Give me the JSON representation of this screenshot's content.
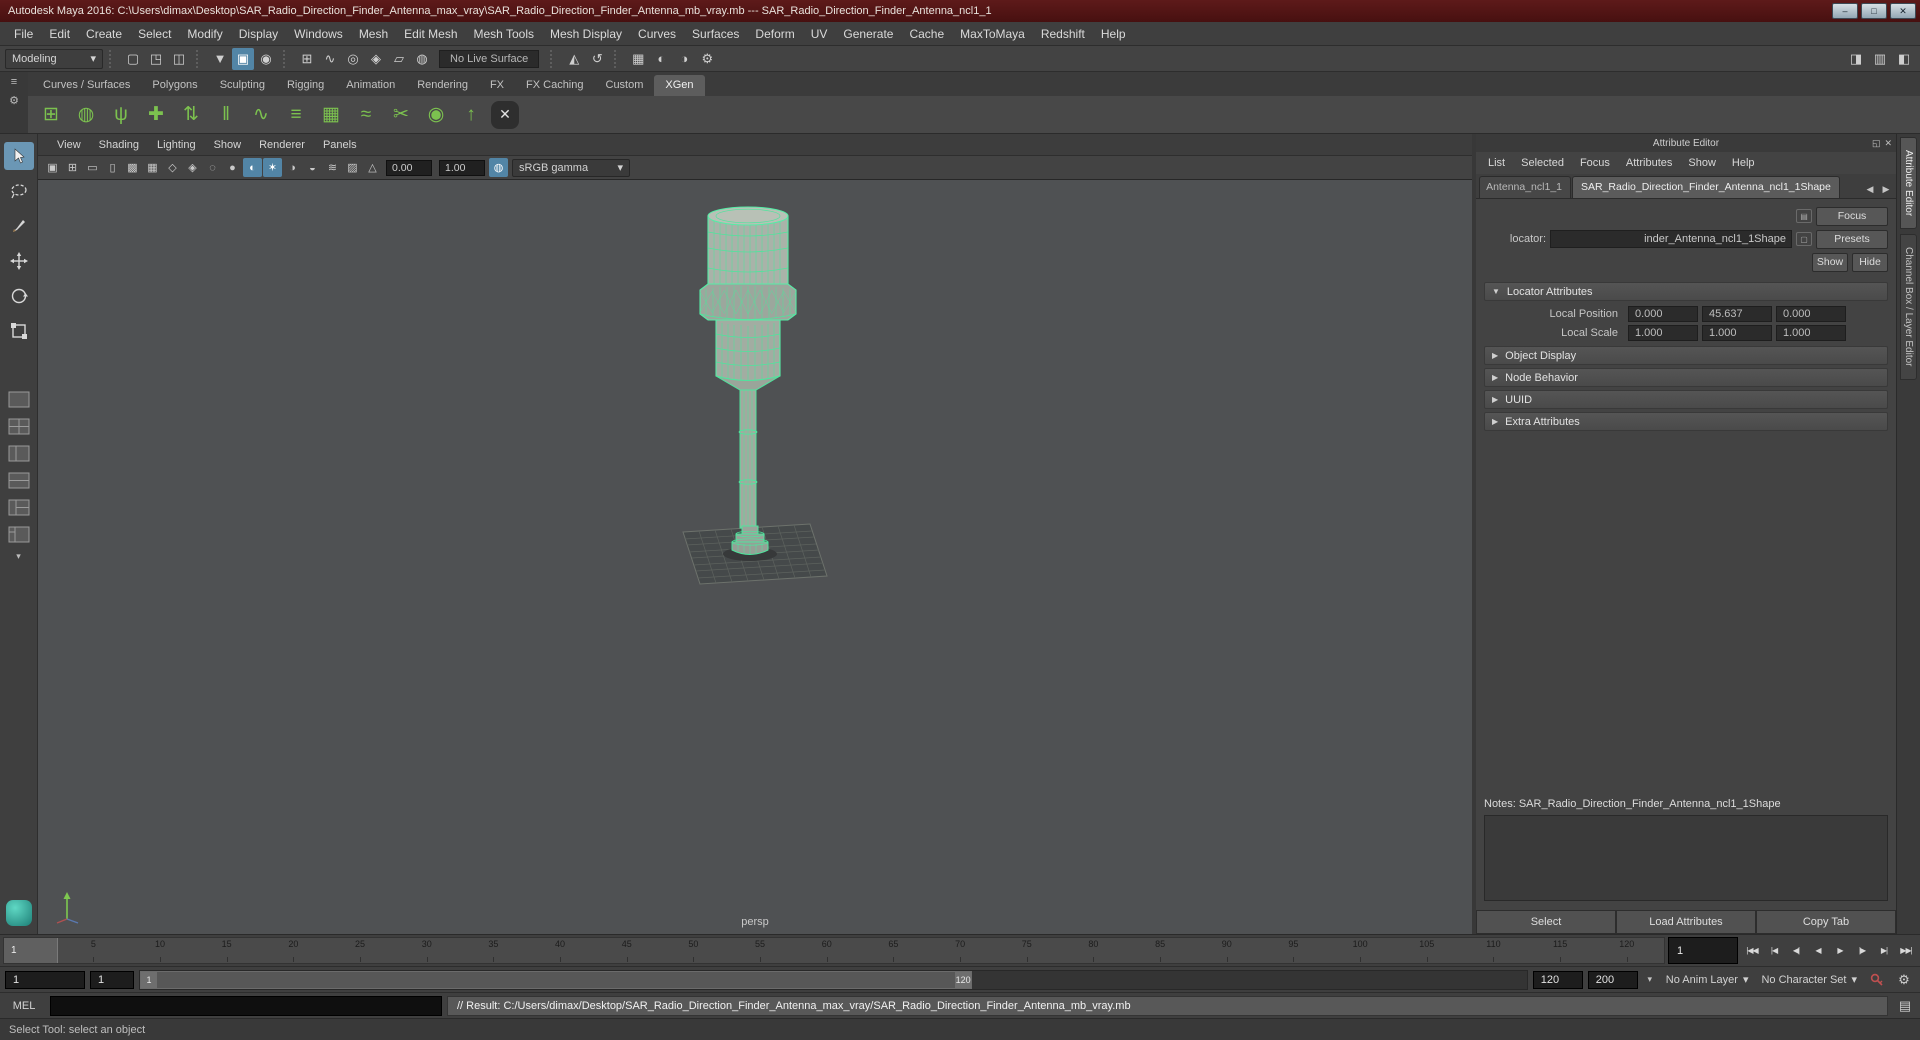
{
  "icons": {
    "window_min": "–",
    "window_max": "□",
    "window_close": "✕",
    "caret_down": "▾",
    "panel_float": "◱",
    "panel_close": "✕",
    "tab_prev": "◀",
    "tab_next": "▶",
    "section_open": "▼",
    "section_closed": "▶",
    "shelf_menu": "≡",
    "shelf_gear": "⚙",
    "pin": "▤",
    "list": "▢",
    "script_editor": "▤",
    "anim_prefs": "⚙"
  },
  "title_bar": {
    "title": "Autodesk Maya 2016: C:\\Users\\dimax\\Desktop\\SAR_Radio_Direction_Finder_Antenna_max_vray\\SAR_Radio_Direction_Finder_Antenna_mb_vray.mb   ---   SAR_Radio_Direction_Finder_Antenna_ncl1_1"
  },
  "menubar": {
    "items": [
      "File",
      "Edit",
      "Create",
      "Select",
      "Modify",
      "Display",
      "Windows",
      "Mesh",
      "Edit Mesh",
      "Mesh Tools",
      "Mesh Display",
      "Curves",
      "Surfaces",
      "Deform",
      "UV",
      "Generate",
      "Cache",
      "MaxToMaya",
      "Redshift",
      "Help"
    ]
  },
  "status_line": {
    "menuset": "Modeling",
    "live_surface": "No Live Surface",
    "file_icons": [
      {
        "name": "new-scene-icon",
        "glyph": "▢"
      },
      {
        "name": "open-scene-icon",
        "glyph": "◳"
      },
      {
        "name": "save-scene-icon",
        "glyph": "◫"
      }
    ],
    "select_icons": [
      {
        "name": "select-by-hierarchy-icon",
        "glyph": "▼"
      },
      {
        "name": "select-by-object-type-icon",
        "glyph": "▣",
        "active": true
      },
      {
        "name": "select-by-component-icon",
        "glyph": "◉"
      }
    ],
    "snap_icons": [
      {
        "name": "snap-to-grid-icon",
        "glyph": "⊞"
      },
      {
        "name": "snap-to-curve-icon",
        "glyph": "∿"
      },
      {
        "name": "snap-to-point-icon",
        "glyph": "◎"
      },
      {
        "name": "snap-to-projected-center-icon",
        "glyph": "◈"
      },
      {
        "name": "snap-to-view-plane-icon",
        "glyph": "▱"
      },
      {
        "name": "make-live-icon",
        "glyph": "◍"
      }
    ],
    "symmetry_icons": [
      {
        "name": "symmetry-icon",
        "glyph": "◭"
      },
      {
        "name": "construction-history-icon",
        "glyph": "↺"
      }
    ],
    "render_icons": [
      {
        "name": "render-view-icon",
        "glyph": "▦"
      },
      {
        "name": "render-current-frame-icon",
        "glyph": "◐"
      },
      {
        "name": "ipr-render-icon",
        "glyph": "◑"
      },
      {
        "name": "render-settings-icon",
        "glyph": "⚙"
      }
    ],
    "right_icons": [
      {
        "name": "toggle-sidebar-icon",
        "glyph": "◨"
      },
      {
        "name": "toggle-tool-settings-icon",
        "glyph": "▥"
      },
      {
        "name": "toggle-channel-box-icon",
        "glyph": "◧"
      }
    ]
  },
  "shelf": {
    "tabs": [
      {
        "label": "Curves / Surfaces"
      },
      {
        "label": "Polygons"
      },
      {
        "label": "Sculpting"
      },
      {
        "label": "Rigging"
      },
      {
        "label": "Animation"
      },
      {
        "label": "Rendering"
      },
      {
        "label": "FX"
      },
      {
        "label": "FX Caching"
      },
      {
        "label": "Custom"
      },
      {
        "label": "XGen",
        "active": true
      }
    ],
    "icons": [
      {
        "name": "xgen-open-editor-icon",
        "glyph": "⊞"
      },
      {
        "name": "xgen-create-description-icon",
        "glyph": "◍"
      },
      {
        "name": "xgen-grass-preset-icon",
        "glyph": "ψ"
      },
      {
        "name": "xgen-add-guide-icon",
        "glyph": "✚"
      },
      {
        "name": "xgen-move-guide-icon",
        "glyph": "⇅"
      },
      {
        "name": "xgen-duplicate-guide-icon",
        "glyph": "‖"
      },
      {
        "name": "xgen-curve-utilities-icon",
        "glyph": "∿"
      },
      {
        "name": "xgen-comb-icon",
        "glyph": "≡"
      },
      {
        "name": "xgen-density-mask-icon",
        "glyph": "▦"
      },
      {
        "name": "xgen-clump-modifier-icon",
        "glyph": "≈"
      },
      {
        "name": "xgen-cut-hair-icon",
        "glyph": "✂"
      },
      {
        "name": "xgen-preview-icon",
        "glyph": "◉"
      },
      {
        "name": "xgen-export-icon",
        "glyph": "↑"
      },
      {
        "name": "xgen-logo-icon",
        "glyph": "✕",
        "cls": "badge"
      }
    ]
  },
  "viewport": {
    "menus": [
      "View",
      "Shading",
      "Lighting",
      "Show",
      "Renderer",
      "Panels"
    ],
    "icons": [
      {
        "name": "select-camera-icon",
        "glyph": "▣"
      },
      {
        "name": "grid-toggle-icon",
        "glyph": "⊞"
      },
      {
        "name": "film-gate-icon",
        "glyph": "▭"
      },
      {
        "name": "resolution-gate-icon",
        "glyph": "▯"
      },
      {
        "name": "gate-mask-icon",
        "glyph": "▩"
      },
      {
        "name": "field-chart-icon",
        "glyph": "▦"
      },
      {
        "name": "safe-action-icon",
        "glyph": "◇"
      },
      {
        "name": "safe-title-icon",
        "glyph": "◈"
      },
      {
        "name": "wireframe-icon",
        "glyph": "◌"
      },
      {
        "name": "smooth-shade-icon",
        "glyph": "●"
      },
      {
        "name": "textured-icon",
        "glyph": "◐",
        "active": true
      },
      {
        "name": "use-all-lights-icon",
        "glyph": "✶",
        "active": true
      },
      {
        "name": "shadows-icon",
        "glyph": "◑"
      },
      {
        "name": "ambient-occlusion-icon",
        "glyph": "◒"
      },
      {
        "name": "motion-blur-icon",
        "glyph": "≋"
      },
      {
        "name": "xray-icon",
        "glyph": "▨"
      },
      {
        "name": "isolate-select-icon",
        "glyph": "△"
      }
    ],
    "exposure": "0.00",
    "gamma": "1.00",
    "color_managed_icon": {
      "glyph": "◍"
    },
    "view_transform": "sRGB gamma",
    "camera": "persp"
  },
  "attribute_editor": {
    "panel_title": "Attribute Editor",
    "menus": [
      "List",
      "Selected",
      "Focus",
      "Attributes",
      "Show",
      "Help"
    ],
    "tabs": [
      {
        "label": "Antenna_ncl1_1"
      },
      {
        "label": "SAR_Radio_Direction_Finder_Antenna_ncl1_1Shape",
        "active": true
      }
    ],
    "focus_button": "Focus",
    "presets_button": "Presets",
    "show_button": "Show",
    "hide_button": "Hide",
    "node_type_label": "locator:",
    "node_name": "inder_Antenna_ncl1_1Shape",
    "sections": {
      "locator": {
        "title": "Locator Attributes",
        "rows": [
          {
            "label": "Local Position",
            "v0": "0.000",
            "v1": "45.637",
            "v2": "0.000"
          },
          {
            "label": "Local Scale",
            "v0": "1.000",
            "v1": "1.000",
            "v2": "1.000"
          }
        ]
      },
      "collapsed": [
        {
          "label": "Object Display",
          "name": "section-object-display"
        },
        {
          "label": "Node Behavior",
          "name": "section-node-behavior"
        },
        {
          "label": "UUID",
          "name": "section-uuid"
        },
        {
          "label": "Extra Attributes",
          "name": "section-extra-attributes"
        }
      ]
    },
    "notes_label": "Notes: SAR_Radio_Direction_Finder_Antenna_ncl1_1Shape",
    "footer_buttons": [
      {
        "label": "Select",
        "name": "select-button"
      },
      {
        "label": "Load Attributes",
        "name": "load-attributes-button"
      },
      {
        "label": "Copy Tab",
        "name": "copy-tab-button"
      }
    ]
  },
  "dock": {
    "tabs": [
      {
        "label": "Attribute Editor",
        "active": true,
        "name": "dock-tab-attribute-editor"
      },
      {
        "label": "Channel Box / Layer Editor",
        "name": "dock-tab-channel-box"
      }
    ]
  },
  "timeline": {
    "current_frame": "1",
    "ticks": [
      "5",
      "10",
      "15",
      "20",
      "25",
      "30",
      "35",
      "40",
      "45",
      "50",
      "55",
      "60",
      "65",
      "70",
      "75",
      "80",
      "85",
      "90",
      "95",
      "100",
      "105",
      "110",
      "115",
      "120"
    ],
    "current_time": "1",
    "playback": [
      {
        "name": "go-to-start-button",
        "glyph": "|◀◀"
      },
      {
        "name": "step-back-frame-button",
        "glyph": "|◀"
      },
      {
        "name": "step-back-key-button",
        "glyph": "◀|"
      },
      {
        "name": "play-backwards-button",
        "glyph": "◀"
      },
      {
        "name": "play-forwards-button",
        "glyph": "▶"
      },
      {
        "name": "step-forward-key-button",
        "glyph": "|▶"
      },
      {
        "name": "step-forward-frame-button",
        "glyph": "▶|"
      },
      {
        "name": "go-to-end-button",
        "glyph": "▶▶|"
      }
    ]
  },
  "range_slider": {
    "anim_start": "1",
    "playback_start": "1",
    "bar_start": "1",
    "bar_end": "120",
    "playback_end": "120",
    "anim_end": "200",
    "anim_layer": "No Anim Layer",
    "character_set": "No Character Set"
  },
  "command_line": {
    "label": "MEL",
    "input_value": "",
    "result": "// Result: C:/Users/dimax/Desktop/SAR_Radio_Direction_Finder_Antenna_max_vray/SAR_Radio_Direction_Finder_Antenna_mb_vray.mb"
  },
  "help_line": {
    "text": "Select Tool: select an object"
  }
}
